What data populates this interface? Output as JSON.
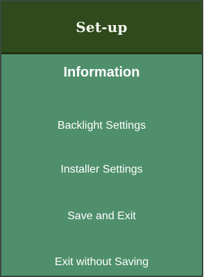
{
  "menu": {
    "title": "Set-up",
    "items": [
      {
        "label": "Information",
        "selected": true
      },
      {
        "label": "Backlight Settings",
        "selected": false
      },
      {
        "label": "Installer Settings",
        "selected": false
      },
      {
        "label": "Save and Exit",
        "selected": false
      },
      {
        "label": "Exit without Saving",
        "selected": false
      }
    ]
  },
  "colors": {
    "header_bg": "#2f4a1c",
    "list_bg": "#4f8f6c",
    "text": "#ffffff"
  }
}
